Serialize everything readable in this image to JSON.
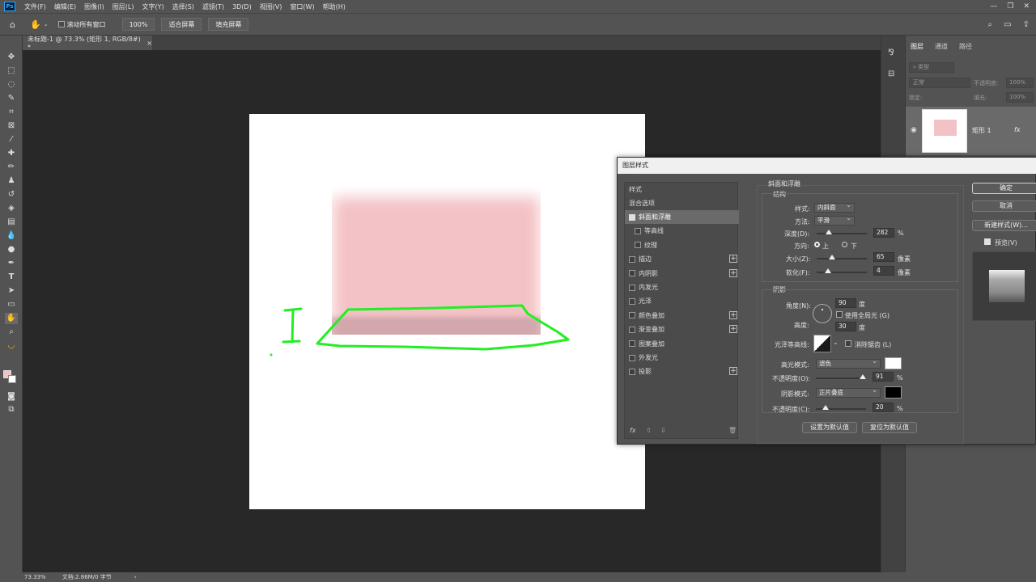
{
  "menubar": {
    "logo": "Ps",
    "items": [
      "文件(F)",
      "编辑(E)",
      "图像(I)",
      "图层(L)",
      "文字(Y)",
      "选择(S)",
      "滤镜(T)",
      "3D(D)",
      "视图(V)",
      "窗口(W)",
      "帮助(H)"
    ],
    "win_min": "—",
    "win_restore": "❐",
    "win_close": "✕"
  },
  "options": {
    "scroll_all_label": "滚动所有窗口",
    "zoom_value": "100%",
    "fit_screen": "适合屏幕",
    "fill_screen": "填充屏幕"
  },
  "document": {
    "tab_title": "未标题-1 @ 73.3% (矩形 1, RGB/8#) *",
    "tab_close": "×"
  },
  "status": {
    "zoom": "73.33%",
    "doc_info": "文档:2.86M/0 字节",
    "arrow": "›"
  },
  "panels": {
    "tabs": [
      "图层",
      "通道",
      "路径"
    ],
    "filter_placeholder": "类型",
    "blend_mode": "正常",
    "opacity_label": "不透明度:",
    "opacity_value": "100%",
    "lock_label": "锁定:",
    "fill_label": "填充:",
    "fill_value": "100%",
    "layer_name": "矩形 1",
    "layer_fx": "fx"
  },
  "dialog": {
    "title": "图层样式",
    "styles_header": "样式",
    "blend_options": "混合选项",
    "style_items": [
      {
        "label": "斜面和浮雕",
        "checked": true,
        "active": true,
        "plus": false,
        "sub": false
      },
      {
        "label": "等高线",
        "checked": false,
        "active": false,
        "plus": false,
        "sub": true
      },
      {
        "label": "纹理",
        "checked": false,
        "active": false,
        "plus": false,
        "sub": true
      },
      {
        "label": "描边",
        "checked": false,
        "active": false,
        "plus": true,
        "sub": false
      },
      {
        "label": "内阴影",
        "checked": false,
        "active": false,
        "plus": true,
        "sub": false
      },
      {
        "label": "内发光",
        "checked": false,
        "active": false,
        "plus": false,
        "sub": false
      },
      {
        "label": "光泽",
        "checked": false,
        "active": false,
        "plus": false,
        "sub": false
      },
      {
        "label": "颜色叠加",
        "checked": false,
        "active": false,
        "plus": true,
        "sub": false
      },
      {
        "label": "渐变叠加",
        "checked": false,
        "active": false,
        "plus": true,
        "sub": false
      },
      {
        "label": "图案叠加",
        "checked": false,
        "active": false,
        "plus": false,
        "sub": false
      },
      {
        "label": "外发光",
        "checked": false,
        "active": false,
        "plus": false,
        "sub": false
      },
      {
        "label": "投影",
        "checked": false,
        "active": false,
        "plus": true,
        "sub": false
      }
    ],
    "section_title": "斜面和浮雕",
    "structure_title": "结构",
    "style_label": "样式:",
    "style_value": "内斜面",
    "technique_label": "方法:",
    "technique_value": "平滑",
    "depth_label": "深度(D):",
    "depth_value": "282",
    "depth_unit": "%",
    "direction_label": "方向:",
    "dir_up": "上",
    "dir_down": "下",
    "size_label": "大小(Z):",
    "size_value": "65",
    "size_unit": "像素",
    "soften_label": "软化(F):",
    "soften_value": "4",
    "soften_unit": "像素",
    "shading_title": "阴影",
    "angle_label": "角度(N):",
    "angle_value": "90",
    "angle_unit": "度",
    "global_light": "使用全局光 (G)",
    "altitude_label": "高度:",
    "altitude_value": "30",
    "altitude_unit": "度",
    "gloss_label": "光泽等高线:",
    "antialias": "消除锯齿 (L)",
    "highlight_mode_label": "高光模式:",
    "highlight_mode_value": "滤色",
    "highlight_opacity_label": "不透明度(O):",
    "highlight_opacity_value": "91",
    "highlight_unit": "%",
    "shadow_mode_label": "阴影模式:",
    "shadow_mode_value": "正片叠底",
    "shadow_opacity_label": "不透明度(C):",
    "shadow_opacity_value": "20",
    "shadow_unit": "%",
    "make_default": "设置为默认值",
    "reset_default": "复位为默认值",
    "ok": "确定",
    "cancel": "取消",
    "new_style": "新建样式(W)...",
    "preview": "预览(V)",
    "footer_fx": "fx",
    "highlight_color": "#ffffff",
    "shadow_color": "#000000"
  },
  "canvas": {
    "rect_color": "#f3c2c6",
    "annotation_color": "#22ee22"
  }
}
